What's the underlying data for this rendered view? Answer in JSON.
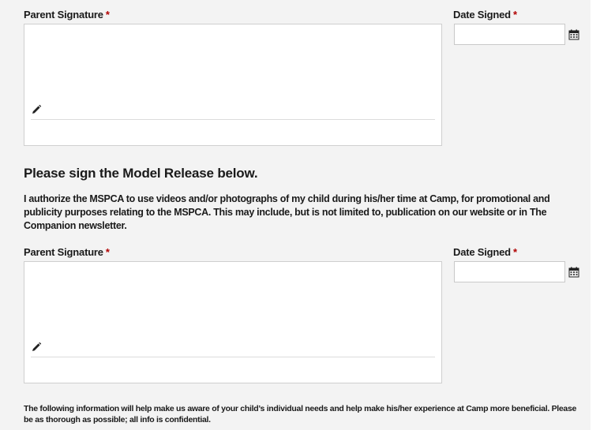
{
  "section1": {
    "signature_label": "Parent Signature",
    "date_label": "Date Signed",
    "required_mark": "*",
    "date_value": ""
  },
  "model_release": {
    "heading": "Please sign the Model Release below.",
    "text": "I authorize the MSPCA to use videos and/or photographs of my child during his/her time at Camp, for promotional and publicity purposes relating to the MSPCA. This may include, but is not limited to, publication on our website or in The Companion newsletter."
  },
  "section2": {
    "signature_label": "Parent Signature",
    "date_label": "Date Signed",
    "required_mark": "*",
    "date_value": ""
  },
  "footer_note": "The following information will help make us aware of your child’s individual needs and help make his/her experience at Camp more beneficial. Please be as thorough as possible; all info is confidential.",
  "icons": {
    "signature_pen": "pencil-icon",
    "date_picker": "calendar-icon"
  },
  "colors": {
    "required": "#b00000",
    "panel_background": "#f3f3f3"
  }
}
